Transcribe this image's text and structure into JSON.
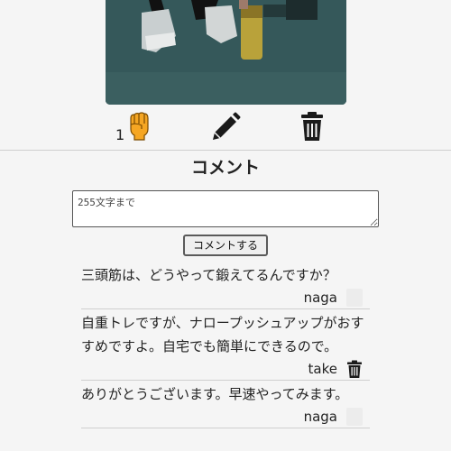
{
  "post": {
    "like_count": "1",
    "icons": {
      "like": "raised-fist-icon",
      "edit": "pencil-icon",
      "delete": "trash-icon"
    },
    "like_color": "#f5a623"
  },
  "comments_section": {
    "heading": "コメント",
    "input_placeholder": "255文字まで",
    "submit_label": "コメントする",
    "items": [
      {
        "text": "三頭筋は、どうやって鍛えてるんですか？",
        "author": "naga",
        "deletable": false
      },
      {
        "text": "自重トレですが、ナロープッシュアップがおすすめですよ。自宅でも簡単にできるので。",
        "author": "take",
        "deletable": true
      },
      {
        "text": "ありがとうございます。早速やってみます。",
        "author": "naga",
        "deletable": false
      }
    ]
  }
}
